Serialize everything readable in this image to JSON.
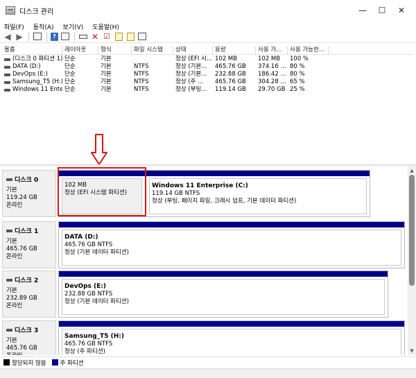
{
  "window": {
    "title": "디스크 관리",
    "minimize": "—",
    "maximize": "☐",
    "close": "✕"
  },
  "menu": [
    "파일(F)",
    "동작(A)",
    "보기(V)",
    "도움말(H)"
  ],
  "volume_table": {
    "columns": [
      "볼륨",
      "레이아웃",
      "형식",
      "파일 시스템",
      "상태",
      "용량",
      "사용 가...",
      "사용 가능한..."
    ],
    "rows": [
      {
        "volume": "(디스크 0 파티션 1)",
        "layout": "단순",
        "type": "기본",
        "fs": "",
        "status": "정상 (EFI 시...",
        "capacity": "102 MB",
        "free": "102 MB",
        "pct": "100 %"
      },
      {
        "volume": "DATA (D:)",
        "layout": "단순",
        "type": "기본",
        "fs": "NTFS",
        "status": "정상 (기본...",
        "capacity": "465.76 GB",
        "free": "374.16 ...",
        "pct": "80 %"
      },
      {
        "volume": "DevOps (E:)",
        "layout": "단순",
        "type": "기본",
        "fs": "NTFS",
        "status": "정상 (기본...",
        "capacity": "232.88 GB",
        "free": "186.42 ...",
        "pct": "80 %"
      },
      {
        "volume": "Samsung_T5 (H:)",
        "layout": "단순",
        "type": "기본",
        "fs": "NTFS",
        "status": "정상 (주 ...",
        "capacity": "465.76 GB",
        "free": "304.28 ...",
        "pct": "65 %"
      },
      {
        "volume": "Windows 11 Ente...",
        "layout": "단순",
        "type": "기본",
        "fs": "NTFS",
        "status": "정상 (부팅...",
        "capacity": "119.14 GB",
        "free": "29.70 GB",
        "pct": "25 %"
      }
    ]
  },
  "disks": [
    {
      "name": "디스크 0",
      "type": "기본",
      "size": "119.24 GB",
      "state": "온라인",
      "partitions": [
        {
          "name": "",
          "line1": "102 MB",
          "line2": "정상 (EFI 시스템 파티션)"
        },
        {
          "name": "Windows 11 Enterprise  (C:)",
          "line1": "119.14 GB NTFS",
          "line2": "정상 (부팅, 페이지 파일, 크래시 덤프, 기본 데이터 파티션)"
        }
      ]
    },
    {
      "name": "디스크 1",
      "type": "기본",
      "size": "465.76 GB",
      "state": "온라인",
      "partitions": [
        {
          "name": "DATA  (D:)",
          "line1": "465.76 GB NTFS",
          "line2": "정상 (기본 데이터 파티션)"
        }
      ]
    },
    {
      "name": "디스크 2",
      "type": "기본",
      "size": "232.89 GB",
      "state": "온라인",
      "partitions": [
        {
          "name": "DevOps  (E:)",
          "line1": "232.88 GB NTFS",
          "line2": "정상 (기본 데이터 파티션)"
        }
      ]
    },
    {
      "name": "디스크 3",
      "type": "기본",
      "size": "465.76 GB",
      "state": "온라인",
      "partitions": [
        {
          "name": "Samsung_T5  (H:)",
          "line1": "465.76 GB NTFS",
          "line2": "정상 (주 파티션)"
        }
      ]
    }
  ],
  "legend": [
    {
      "label": "할당되지 않음",
      "color": "#000000"
    },
    {
      "label": "주 파티션",
      "color": "#00008b"
    }
  ],
  "colors": {
    "partition_bar": "#00008b",
    "annotation": "#e11010"
  }
}
